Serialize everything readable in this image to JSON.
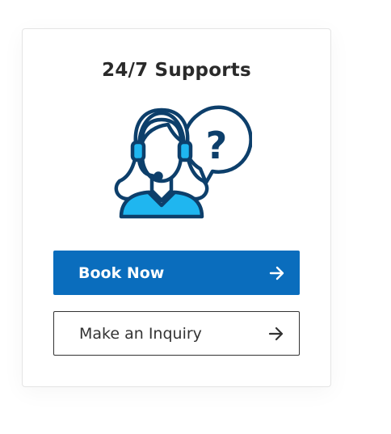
{
  "card": {
    "title": "24/7 Supports",
    "icon": "support-agent-question-icon",
    "colors": {
      "outline": "#0d3f6b",
      "fill": "#1fb6f0"
    }
  },
  "buttons": {
    "book_now": {
      "label": "Book Now",
      "icon": "arrow-right-icon",
      "color": "#0a6dbd"
    },
    "inquiry": {
      "label": "Make an Inquiry",
      "icon": "arrow-right-icon"
    }
  }
}
